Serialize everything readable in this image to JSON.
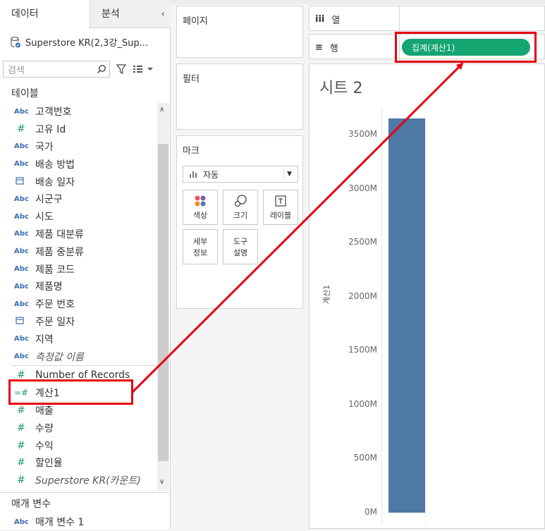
{
  "left_panel": {
    "tabs": [
      "데이터",
      "분석"
    ],
    "collapse_icon": "‹",
    "datasource": "Superstore KR(2,3강_Sup...",
    "search_placeholder": "검색",
    "tables_title": "테이블",
    "fields": [
      {
        "type": "abc",
        "label": "고객번호"
      },
      {
        "type": "num",
        "label": "고유 Id"
      },
      {
        "type": "abc",
        "label": "국가"
      },
      {
        "type": "abc",
        "label": "배송 방법"
      },
      {
        "type": "date",
        "label": "배송 일자"
      },
      {
        "type": "abc",
        "label": "시군구"
      },
      {
        "type": "abc",
        "label": "시도"
      },
      {
        "type": "abc",
        "label": "제품 대분류"
      },
      {
        "type": "abc",
        "label": "제품 중분류"
      },
      {
        "type": "abc",
        "label": "제품 코드"
      },
      {
        "type": "abc",
        "label": "제품명"
      },
      {
        "type": "abc",
        "label": "주문 번호"
      },
      {
        "type": "date",
        "label": "주문 일자"
      },
      {
        "type": "abc",
        "label": "지역"
      },
      {
        "type": "abc",
        "label": "측정값 이름",
        "italic": true
      },
      {
        "type": "num",
        "label": "Number of Records"
      },
      {
        "type": "calc",
        "label": "계산1"
      },
      {
        "type": "num",
        "label": "매출"
      },
      {
        "type": "num",
        "label": "수량"
      },
      {
        "type": "num",
        "label": "수익"
      },
      {
        "type": "num",
        "label": "할인율"
      },
      {
        "type": "num",
        "label": "Superstore KR(카운트)",
        "italic": true
      }
    ],
    "params_title": "매개 변수",
    "param_field": {
      "type": "abc",
      "label": "매개 변수 1"
    }
  },
  "shelves": {
    "pages": "페이지",
    "filters": "필터",
    "marks": "마크",
    "mark_type": "자동",
    "mark_buttons": [
      "색상",
      "크기",
      "레이블",
      "세부\n정보",
      "도구\n설명"
    ],
    "columns": "열",
    "rows": "행",
    "row_pill": "집계(계산1)"
  },
  "view": {
    "sheet_title": "시트 2"
  },
  "chart_data": {
    "type": "bar",
    "categories": [
      ""
    ],
    "series": [
      {
        "values": [
          3650
        ]
      }
    ],
    "ylabel": "계산1",
    "ylim": [
      0,
      3750
    ],
    "ticks": [
      "0M",
      "500M",
      "1000M",
      "1500M",
      "2000M",
      "2500M",
      "3000M",
      "3500M"
    ],
    "tick_values": [
      0,
      500,
      1000,
      1500,
      2000,
      2500,
      3000,
      3500
    ],
    "bar_color": "#4e79a7"
  },
  "colors": {
    "pill": "#14a571",
    "highlight": "#e60012",
    "abc": "#3b6fb6",
    "measure": "#2a9a6e"
  }
}
